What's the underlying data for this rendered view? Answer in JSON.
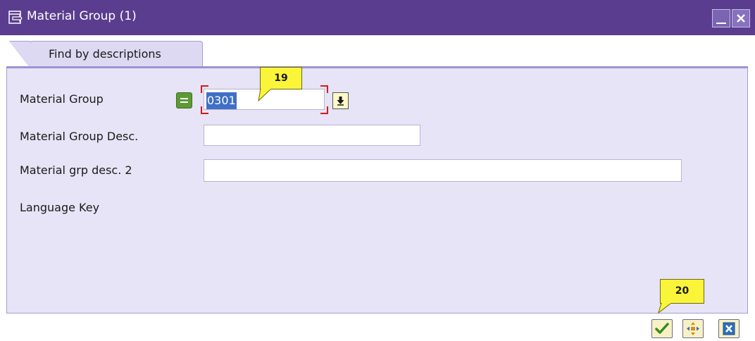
{
  "window": {
    "title": "Material Group (1)",
    "accent_color": "#5a3d8f",
    "icons": [
      "dialog-icon",
      "minimize-icon",
      "close-icon"
    ]
  },
  "tab": {
    "label": "Find by descriptions"
  },
  "form": {
    "material_group": {
      "label": "Material Group",
      "value": "0301",
      "operator": "equals"
    },
    "material_group_desc": {
      "label": "Material Group Desc.",
      "value": ""
    },
    "material_grp_desc2": {
      "label": "Material grp desc. 2",
      "value": ""
    },
    "language_key": {
      "label": "Language Key"
    }
  },
  "callouts": {
    "first": "19",
    "second": "20"
  },
  "footer": {
    "icons": [
      "checkmark-icon",
      "multi-select-icon",
      "cancel-icon"
    ]
  }
}
